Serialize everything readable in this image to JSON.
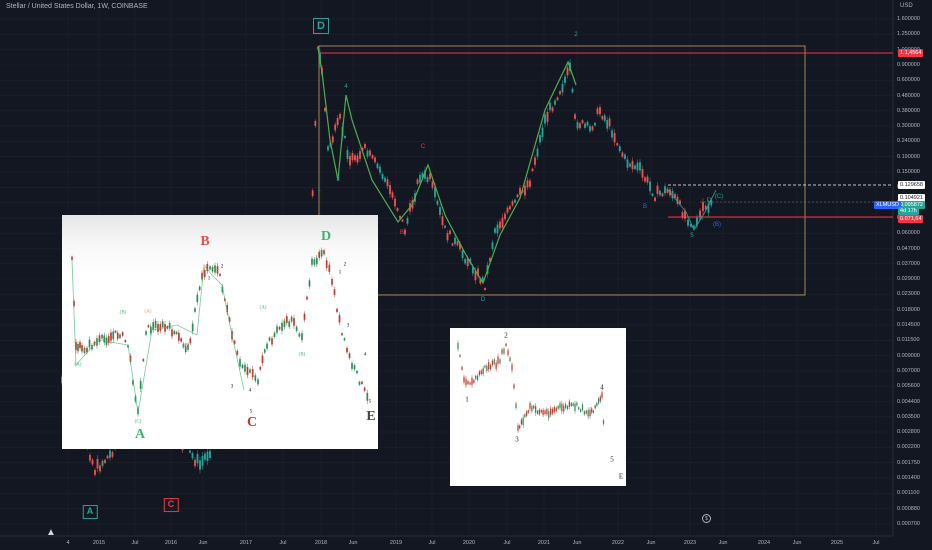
{
  "symbol_title": "Stellar / United States Dollar, 1W, COINBASE",
  "currency_label": "USD",
  "price_axis": [
    "1.600000",
    "1.250000",
    "1.000000",
    "0.900000",
    "0.600000",
    "0.480000",
    "0.380000",
    "0.300000",
    "0.240000",
    "0.190000",
    "0.150000",
    "0.120000",
    "0.100000",
    "0.080000",
    "0.060000",
    "0.047000",
    "0.037000",
    "0.029000",
    "0.023000",
    "0.018000",
    "0.014500",
    "0.011500",
    "0.009000",
    "0.007000",
    "0.005600",
    "0.004400",
    "0.003500",
    "0.002800",
    "0.002200",
    "0.001750",
    "0.001400",
    "0.001100",
    "0.000880",
    "0.000700"
  ],
  "price_tags": [
    {
      "text": "1.1,4564",
      "bg": "#f23645",
      "fg": "#ffffff"
    },
    {
      "text": "0.129658",
      "bg": "#ffffff",
      "fg": "#131722"
    },
    {
      "text": "0.104921",
      "bg": "#ffffff",
      "fg": "#131722"
    },
    {
      "text": "0.095872",
      "bg": "#26a69a",
      "fg": "#ffffff"
    },
    {
      "text": "XLMUSD",
      "bg": "#2962ff",
      "fg": "#ffffff"
    },
    {
      "text": "4d 17h",
      "bg": "#26a69a",
      "fg": "#ffffff"
    },
    {
      "text": "0.071,64",
      "bg": "#f23645",
      "fg": "#ffffff"
    }
  ],
  "time_axis": [
    "4",
    "2015",
    "Jul",
    "2016",
    "Jun",
    "2017",
    "Jul",
    "2018",
    "Jun",
    "2019",
    "Jul",
    "2020",
    "Jul",
    "2021",
    "Jun",
    "2022",
    "Jun",
    "2023",
    "Jun",
    "2024",
    "Jun",
    "2025",
    "Jul"
  ],
  "waves": [
    {
      "t": "D",
      "c": "#26a69a"
    },
    {
      "t": "2",
      "c": "#26a69a"
    },
    {
      "t": "A",
      "c": "#26a69a"
    },
    {
      "t": "C",
      "c": "#f23645"
    },
    {
      "t": "D",
      "c": "#26a69a"
    },
    {
      "t": "B",
      "c": "#f23645"
    },
    {
      "t": "3",
      "c": "#26a69a"
    },
    {
      "t": "C",
      "c": "#f23645"
    },
    {
      "t": "4",
      "c": "#26a69a"
    },
    {
      "t": "1",
      "c": "#26a69a"
    },
    {
      "t": "5",
      "c": "#26a69a"
    },
    {
      "t": "(C)",
      "c": "#26a69a"
    },
    {
      "t": "(B)",
      "c": "#2962ff"
    },
    {
      "t": "A",
      "c": "#26a69a"
    },
    {
      "t": "D",
      "c": "#26a69a"
    },
    {
      "t": "B",
      "c": "#2962ff"
    }
  ],
  "inset1_labels": [
    {
      "t": "B",
      "c": "#e05050"
    },
    {
      "t": "D",
      "c": "#3cb371"
    },
    {
      "t": "(B)",
      "c": "#3cb371"
    },
    {
      "t": "(A)",
      "c": "#c8a060"
    },
    {
      "t": "(A)",
      "c": "#3cb371"
    },
    {
      "t": "(B)",
      "c": "#c87070"
    },
    {
      "t": "(A)",
      "c": "#3cb371"
    },
    {
      "t": "(B)",
      "c": "#3cb371"
    },
    {
      "t": "(C)",
      "c": "#3cb371"
    },
    {
      "t": "A",
      "c": "#3cb371"
    },
    {
      "t": "C",
      "c": "#c0392b"
    },
    {
      "t": "E",
      "c": "#444444"
    },
    {
      "t": "1",
      "c": "#000000"
    },
    {
      "t": "2",
      "c": "#000000"
    },
    {
      "t": "3",
      "c": "#000000"
    },
    {
      "t": "4",
      "c": "#000000"
    },
    {
      "t": "5",
      "c": "#000000"
    },
    {
      "t": "1",
      "c": "#000000"
    },
    {
      "t": "2",
      "c": "#000000"
    },
    {
      "t": "3",
      "c": "#000000"
    },
    {
      "t": "4",
      "c": "#000000"
    },
    {
      "t": "5",
      "c": "#000000"
    }
  ],
  "inset2_labels": [
    "2",
    "1",
    "3",
    "4",
    "5",
    "E"
  ]
}
